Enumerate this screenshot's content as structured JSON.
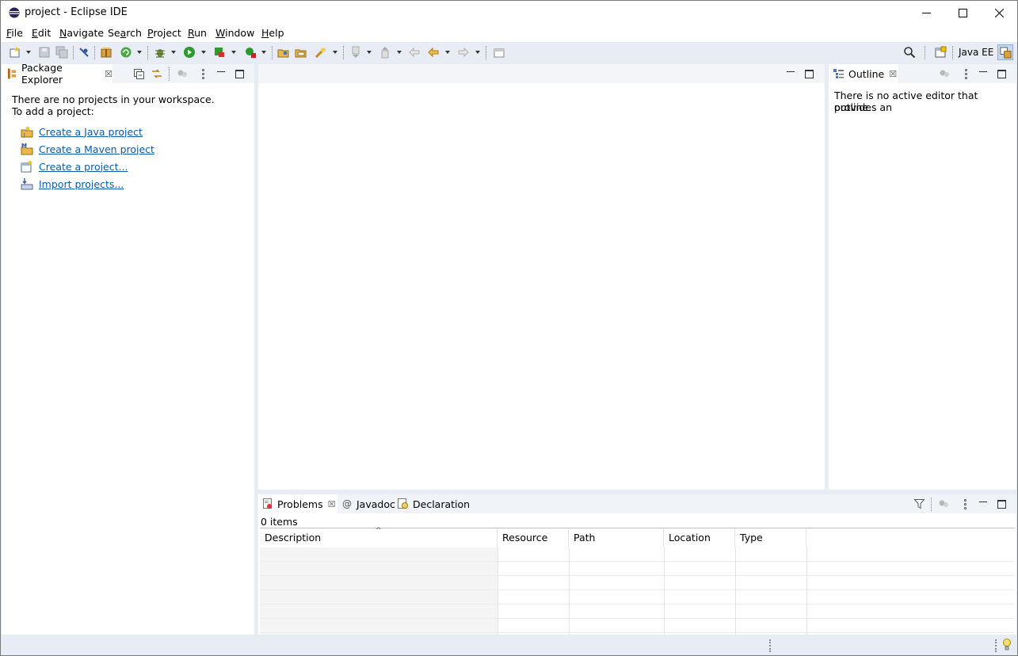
{
  "window": {
    "title": "project - Eclipse IDE",
    "controls": {
      "minimize": "minimize",
      "maximize": "maximize",
      "close": "close"
    }
  },
  "menubar": {
    "items": [
      {
        "pre": "",
        "u": "F",
        "post": "ile"
      },
      {
        "pre": "",
        "u": "E",
        "post": "dit"
      },
      {
        "pre": "",
        "u": "N",
        "post": "avigate"
      },
      {
        "pre": "Se",
        "u": "a",
        "post": "rch"
      },
      {
        "pre": "",
        "u": "P",
        "post": "roject"
      },
      {
        "pre": "",
        "u": "R",
        "post": "un"
      },
      {
        "pre": "",
        "u": "W",
        "post": "indow"
      },
      {
        "pre": "",
        "u": "H",
        "post": "elp"
      }
    ]
  },
  "toolbar": {
    "perspective_label": "Java EE",
    "icons": [
      "new-wizard-icon",
      "save-icon",
      "save-all-icon",
      "skip-breakpoints-icon",
      "new-java-package-icon",
      "refresh-icon",
      "debug-icon",
      "run-icon",
      "coverage-icon",
      "external-tools-icon",
      "open-type-icon",
      "open-task-icon",
      "search-marker-icon",
      "next-annotation-icon",
      "previous-annotation-icon",
      "last-edit-icon",
      "back-icon",
      "forward-icon",
      "pin-editor-icon",
      "search-icon",
      "open-perspective-icon",
      "java-ee-perspective-icon"
    ]
  },
  "package_explorer": {
    "tab_label": "Package Explorer",
    "message_line1": "There are no projects in your workspace.",
    "message_line2": "To add a project:",
    "links": [
      "Create a Java project",
      "Create a Maven project",
      "Create a project...",
      "Import projects..."
    ]
  },
  "outline": {
    "tab_label": "Outline",
    "message_line1": "There is no active editor that provides an",
    "message_line2": "outline."
  },
  "bottom_panel": {
    "tabs": [
      "Problems",
      "Javadoc",
      "Declaration"
    ],
    "item_count": "0 items",
    "columns": [
      "Description",
      "Resource",
      "Path",
      "Location",
      "Type"
    ]
  },
  "colors": {
    "link": "#0b5ba8",
    "chrome_bg": "#e8edf5",
    "panel_header": "#f0f3f8"
  }
}
